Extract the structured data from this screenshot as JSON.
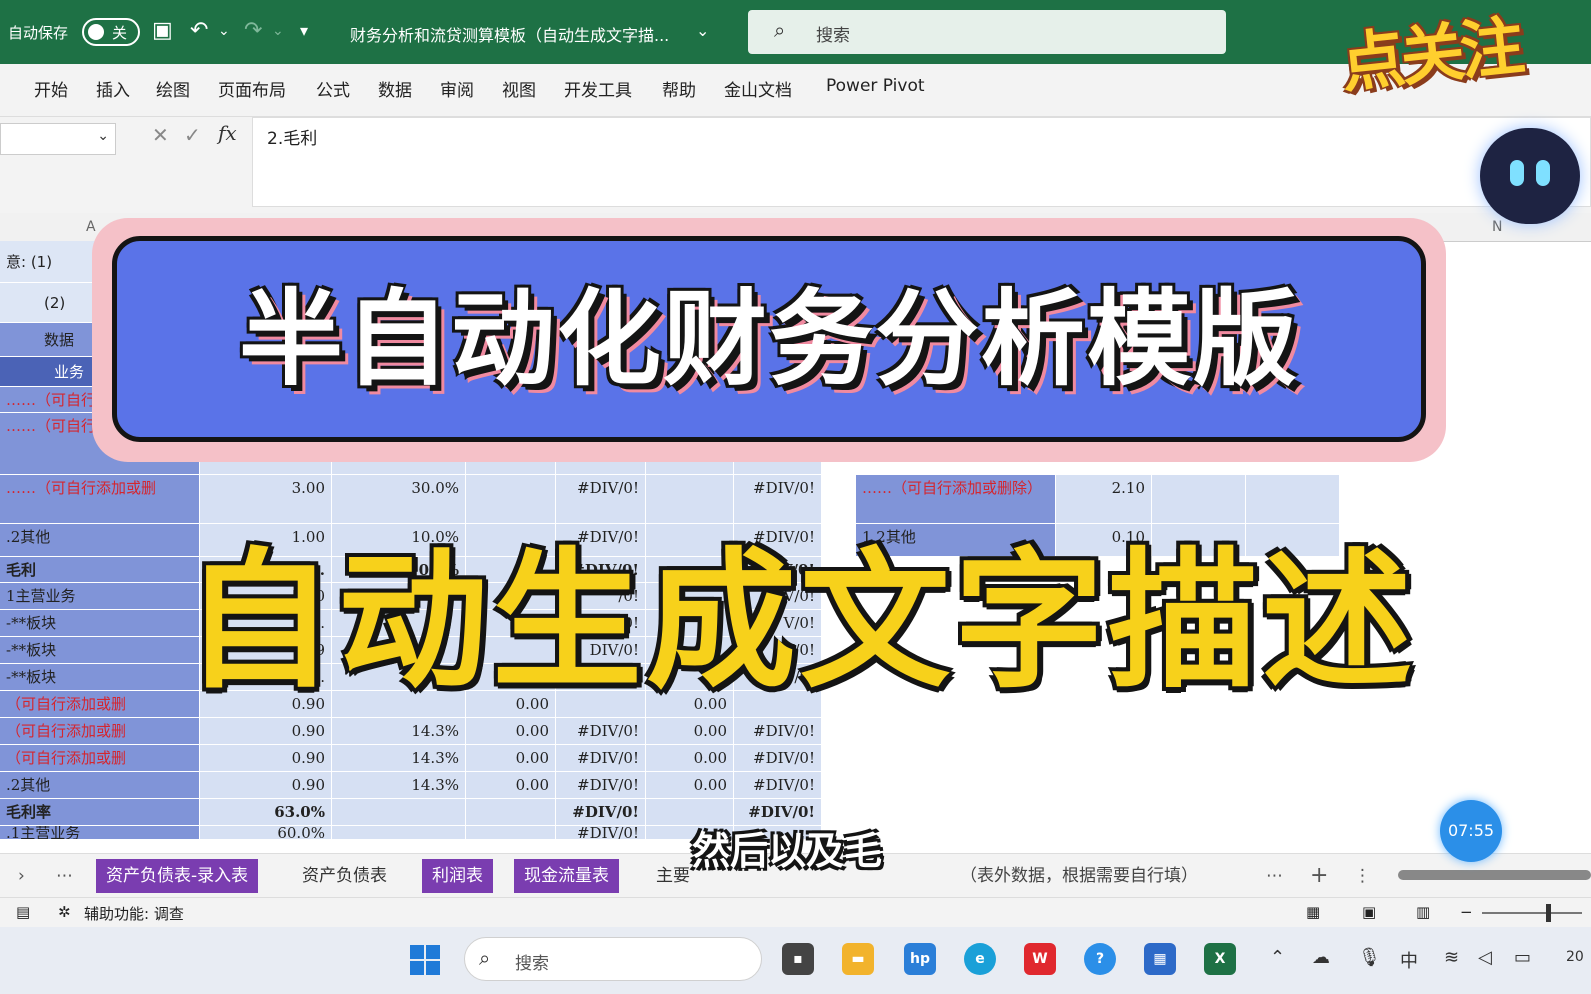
{
  "titlebar": {
    "autosave_label": "自动保存",
    "autosave_state": "关",
    "doc_title": "财务分析和流贷测算模板（自动生成文字描...",
    "search_placeholder": "搜索"
  },
  "ribbon": {
    "tabs": [
      "开始",
      "插入",
      "绘图",
      "页面布局",
      "公式",
      "数据",
      "审阅",
      "视图",
      "开发工具",
      "帮助",
      "金山文档",
      "Power Pivot"
    ]
  },
  "formula_bar": {
    "content": "2.毛利"
  },
  "columns": {
    "a": "A",
    "n": "N"
  },
  "sheet": {
    "note1": "意:  (1)",
    "note2": "(2)",
    "hdr_data": "数据",
    "hdr_business": "业务",
    "rows": [
      {
        "label": "……（可自行",
        "red": true
      },
      {
        "label": "……（可自行",
        "red": true
      },
      {
        "label": "……（可自行添加或删",
        "red": true,
        "b": "3.00",
        "c": "30.0%",
        "e": "#DIV/0!",
        "g": "#DIV/0!"
      },
      {
        "label": ".2其他",
        "b": "1.00",
        "c": "10.0%",
        "e": "#DIV/0!",
        "g": "#DIV/0!"
      },
      {
        "label": "毛利",
        "bold": true,
        "b": "6.",
        "c": "0.0%",
        "e": "#DIV/0!",
        "g": "V/0!"
      },
      {
        "label": "1主营业务",
        "b": "5.40",
        "e": "/0!",
        "g": "V/0!"
      },
      {
        "label": "-**板块",
        "b": "0.",
        "e": "DIV/0!",
        "g": "V/0!"
      },
      {
        "label": "-**板块",
        "b": "0.9",
        "e": "DIV/0!",
        "g": "V/0!"
      },
      {
        "label": "-**板块",
        "b": "0.",
        "e": "DIV/0!",
        "g": "V/0!"
      },
      {
        "label": "（可自行添加或删",
        "red": true,
        "b": "0.90",
        "d": "0.00",
        "f": "0.00"
      },
      {
        "label": "（可自行添加或删",
        "red": true,
        "b": "0.90",
        "c": "14.3%",
        "d": "0.00",
        "e": "#DIV/0!",
        "f": "0.00",
        "g": "#DIV/0!"
      },
      {
        "label": "（可自行添加或删",
        "red": true,
        "b": "0.90",
        "c": "14.3%",
        "d": "0.00",
        "e": "#DIV/0!",
        "f": "0.00",
        "g": "#DIV/0!"
      },
      {
        "label": ".2其他",
        "b": "0.90",
        "c": "14.3%",
        "d": "0.00",
        "e": "#DIV/0!",
        "f": "0.00",
        "g": "#DIV/0!"
      },
      {
        "label": "毛利率",
        "bold": true,
        "b": "63.0%",
        "e": "#DIV/0!",
        "g": "#DIV/0!"
      },
      {
        "label": ".1主营业务",
        "b": "60.0%",
        "e": "#DIV/0!"
      }
    ],
    "right_rows": [
      {
        "label": "……（可自行添加或删除）",
        "red": true,
        "val": "2.10"
      },
      {
        "label": "1.2其他",
        "val": "0.10"
      }
    ]
  },
  "sheet_tabs": [
    {
      "label": "资产负债表-录入表",
      "active": true
    },
    {
      "label": "资产负债表",
      "active": false
    },
    {
      "label": "利润表",
      "active": true
    },
    {
      "label": "现金流量表",
      "active": true
    },
    {
      "label": "主要",
      "active": false
    }
  ],
  "sheet_note": "（表外数据，根据需要自行填）",
  "status": {
    "accessibility": "辅助功能: 调查"
  },
  "taskbar": {
    "search_placeholder": "搜索",
    "ime": "中",
    "clock_partial": "20"
  },
  "overlay": {
    "banner": "半自动化财务分析模版",
    "subtitle": "自动生成文字描述",
    "caption": "然后以及毛",
    "sticker": "点关注",
    "timer": "07:55"
  },
  "colors": {
    "excel_green": "#1e7145",
    "banner_blue": "#5a73e8",
    "banner_pink": "#f5c1c8",
    "subtitle_yellow": "#f7d11b",
    "tab_purple": "#7a3db0"
  }
}
